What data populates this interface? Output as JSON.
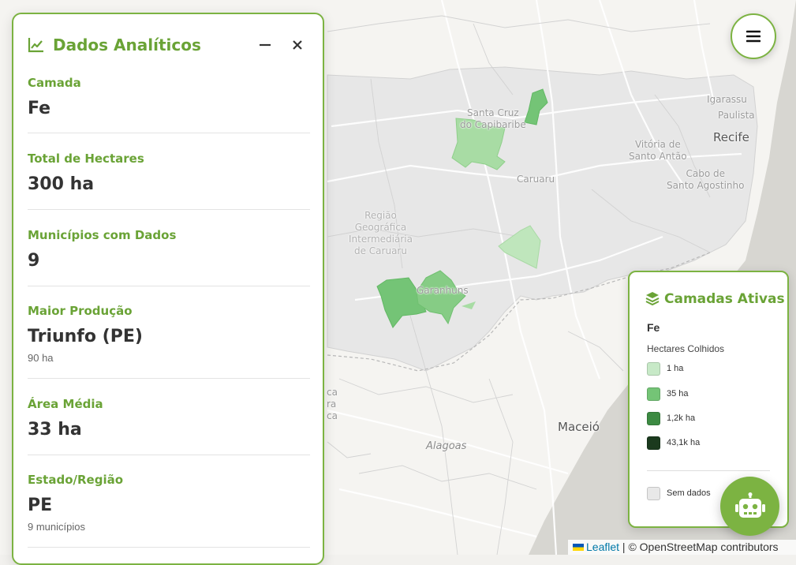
{
  "analytics": {
    "title": "Dados Analíticos",
    "stats": [
      {
        "label": "Camada",
        "value": "Fe",
        "sub": ""
      },
      {
        "label": "Total de Hectares",
        "value": "300 ha",
        "sub": ""
      },
      {
        "label": "Municípios com Dados",
        "value": "9",
        "sub": ""
      },
      {
        "label": "Maior Produção",
        "value": "Triunfo (PE)",
        "sub": "90 ha"
      },
      {
        "label": "Área Média",
        "value": "33 ha",
        "sub": ""
      },
      {
        "label": "Estado/Região",
        "value": "PE",
        "sub": "9 municípios"
      }
    ]
  },
  "legend": {
    "title": "Camadas Ativas",
    "layer": "Fe",
    "subtitle": "Hectares Colhidos",
    "items": [
      {
        "label": "1 ha",
        "color": "#c7e9c7"
      },
      {
        "label": "35 ha",
        "color": "#74c476"
      },
      {
        "label": "1,2k ha",
        "color": "#3c8a42"
      },
      {
        "label": "43,1k ha",
        "color": "#1b3a1e"
      }
    ],
    "no_data": {
      "label": "Sem dados",
      "color": "#e8e8e8"
    }
  },
  "map": {
    "labels": {
      "santa_cruz": "Santa Cruz\ndo Capibaribe",
      "caruaru": "Caruaru",
      "regiao": "Região\nGeográfica\nIntermediária\nde Caruaru",
      "garanhuns": "Garanhuns",
      "igarassu": "Igarassu",
      "paulista": "Paulista",
      "recife": "Recife",
      "vitoria": "Vitória de\nSanto Antão",
      "cabo": "Cabo de\nSanto Agostinho",
      "maceio": "Maceió",
      "alagoas": "Alagoas",
      "left_fragment": "ca\nra\nca"
    }
  },
  "attribution": {
    "leaflet": "Leaflet",
    "separator": " | © ",
    "osm": "OpenStreetMap contributors"
  },
  "colors": {
    "accent": "#7cb342",
    "accent_text": "#6aa336",
    "region_fill": "#e6e6e6",
    "ocean": "#d4d3ce"
  },
  "icons": {
    "analytics": "chart-line-icon",
    "minimize": "minimize-icon",
    "close": "close-icon",
    "menu": "hamburger-menu-icon",
    "layers": "layers-icon",
    "bot": "robot-icon"
  }
}
